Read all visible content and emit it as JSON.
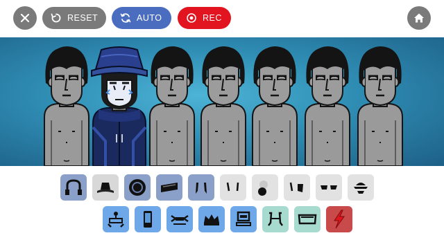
{
  "toolbar": {
    "close_icon": "close-x-icon",
    "reset_label": "RESET",
    "reset_icon": "restart-icon",
    "auto_label": "AUTO",
    "auto_icon": "refresh-icon",
    "rec_label": "REC",
    "rec_icon": "record-icon",
    "home_icon": "home-icon"
  },
  "colors": {
    "stage_bg": "#2f8db4",
    "button_gray": "#7a7a7a",
    "auto_blue": "#4a6dc0",
    "rec_red": "#e1141f",
    "beats_tile": "#8aa0c8",
    "effects_tile": "#e2e2e2",
    "melody_tile": "#6ea8e8",
    "chorus_tile": "#a8dbd0",
    "voice_tile": "#c84a4a"
  },
  "stage": {
    "performers": [
      {
        "slot": 1,
        "state": "idle",
        "costume": "none"
      },
      {
        "slot": 2,
        "state": "active",
        "costume": "blue-bucket-hat-hoodie"
      },
      {
        "slot": 3,
        "state": "idle",
        "costume": "none"
      },
      {
        "slot": 4,
        "state": "idle",
        "costume": "none"
      },
      {
        "slot": 5,
        "state": "idle",
        "costume": "none"
      },
      {
        "slot": 6,
        "state": "idle",
        "costume": "none"
      },
      {
        "slot": 7,
        "state": "idle",
        "costume": "none"
      }
    ]
  },
  "palette": {
    "row1": [
      {
        "icon": "headphones-icon",
        "category": "beats"
      },
      {
        "icon": "bucket-hat-icon",
        "category": "beats"
      },
      {
        "icon": "speaker-disc-icon",
        "category": "beats"
      },
      {
        "icon": "bandana-icon",
        "category": "beats"
      },
      {
        "icon": "sideburns-icon",
        "category": "beats"
      },
      {
        "icon": "eyebrows-icon",
        "category": "effects"
      },
      {
        "icon": "pearl-icon",
        "category": "effects"
      },
      {
        "icon": "earrings-icon",
        "category": "effects"
      },
      {
        "icon": "sunglasses-icon",
        "category": "effects"
      },
      {
        "icon": "cap-icon",
        "category": "effects"
      }
    ],
    "row2": [
      {
        "icon": "antenna-glasses-icon",
        "category": "melody"
      },
      {
        "icon": "phone-icon",
        "category": "melody"
      },
      {
        "icon": "bowtie-icon",
        "category": "melody"
      },
      {
        "icon": "crown-icon",
        "category": "melody"
      },
      {
        "icon": "visor-icon",
        "category": "melody"
      },
      {
        "icon": "mask-icon",
        "category": "chorus"
      },
      {
        "icon": "shades-icon",
        "category": "chorus"
      },
      {
        "icon": "lightning-icon",
        "category": "voice"
      }
    ]
  }
}
